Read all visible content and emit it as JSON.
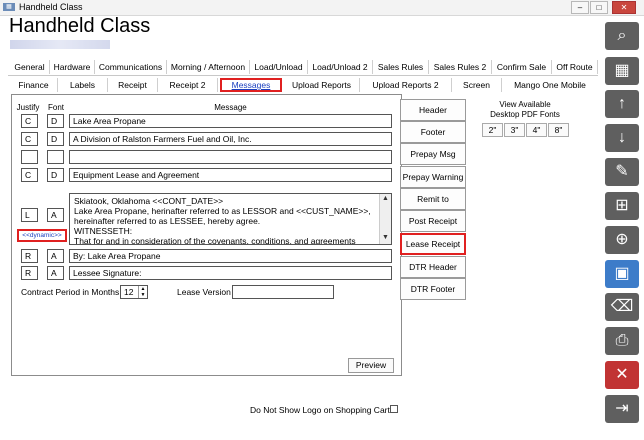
{
  "window": {
    "title": "Handheld Class",
    "app_icon": "app-logo-icon"
  },
  "page": {
    "title": "Handheld Class"
  },
  "tabs_row1": [
    "General",
    "Hardware",
    "Communications",
    "Morning / Afternoon",
    "Load/Unload",
    "Load/Unload 2",
    "Sales Rules",
    "Sales Rules 2",
    "Confirm Sale",
    "Off Route"
  ],
  "tabs_row2": [
    "Finance",
    "Labels",
    "Receipt",
    "Receipt 2",
    "Messages",
    "Upload Reports",
    "Upload Reports 2",
    "Screen",
    "Mango One Mobile"
  ],
  "active_tab": "Messages",
  "headers": {
    "justify": "Justify",
    "font": "Font",
    "message": "Message"
  },
  "rows": [
    {
      "justify": "C",
      "font": "D",
      "message": "Lake Area Propane"
    },
    {
      "justify": "C",
      "font": "D",
      "message": "A Division of Ralston Farmers Fuel and Oil, Inc."
    },
    {
      "justify": "",
      "font": "",
      "message": ""
    },
    {
      "justify": "C",
      "font": "D",
      "message": "Equipment Lease and Agreement"
    }
  ],
  "lease_block": {
    "justify": "L",
    "font": "A",
    "dynamic_label": "<<dynamic>>",
    "lines": [
      "Skiatook, Oklahoma  <<CONT_DATE>>",
      "  Lake Area Propane, herinafter referred to as LESSOR and  <<CUST_NAME>>,",
      "hereinafter referred to as LESSEE, hereby agree.",
      "WITNESSETH:",
      "  That for and in consideration of the covenants, conditions, and agreements"
    ]
  },
  "rows_after": [
    {
      "justify": "R",
      "font": "A",
      "message": "By: Lake Area Propane"
    },
    {
      "justify": "R",
      "font": "A",
      "message": "Lessee Signature:"
    }
  ],
  "contract": {
    "label": "Contract Period in Months",
    "value": "12",
    "lease_version_label": "Lease Version",
    "lease_version_value": ""
  },
  "section_buttons": [
    "Header",
    "Footer",
    "Prepay Msg",
    "Prepay Warning",
    "Remit to",
    "Post Receipt",
    "Lease Receipt",
    "DTR Header",
    "DTR Footer"
  ],
  "highlighted_section": "Lease Receipt",
  "pdf_fonts": {
    "title_line1": "View Available",
    "title_line2": "Desktop PDF Fonts",
    "sizes": [
      "2\"",
      "3\"",
      "4\"",
      "8\""
    ]
  },
  "preview_label": "Preview",
  "logo_option": {
    "label": "Do Not Show Logo on Shopping Cart",
    "checked": false
  },
  "side_icons": [
    "search-icon",
    "grid-icon",
    "arrow-up-icon",
    "arrow-down-icon",
    "edit-icon",
    "new-document-icon",
    "add-record-icon",
    "save-icon",
    "delete-icon",
    "print-icon",
    "cancel-icon",
    "exit-icon"
  ],
  "accent_red": "#e02020",
  "accent_blue": "#3d7cc9"
}
